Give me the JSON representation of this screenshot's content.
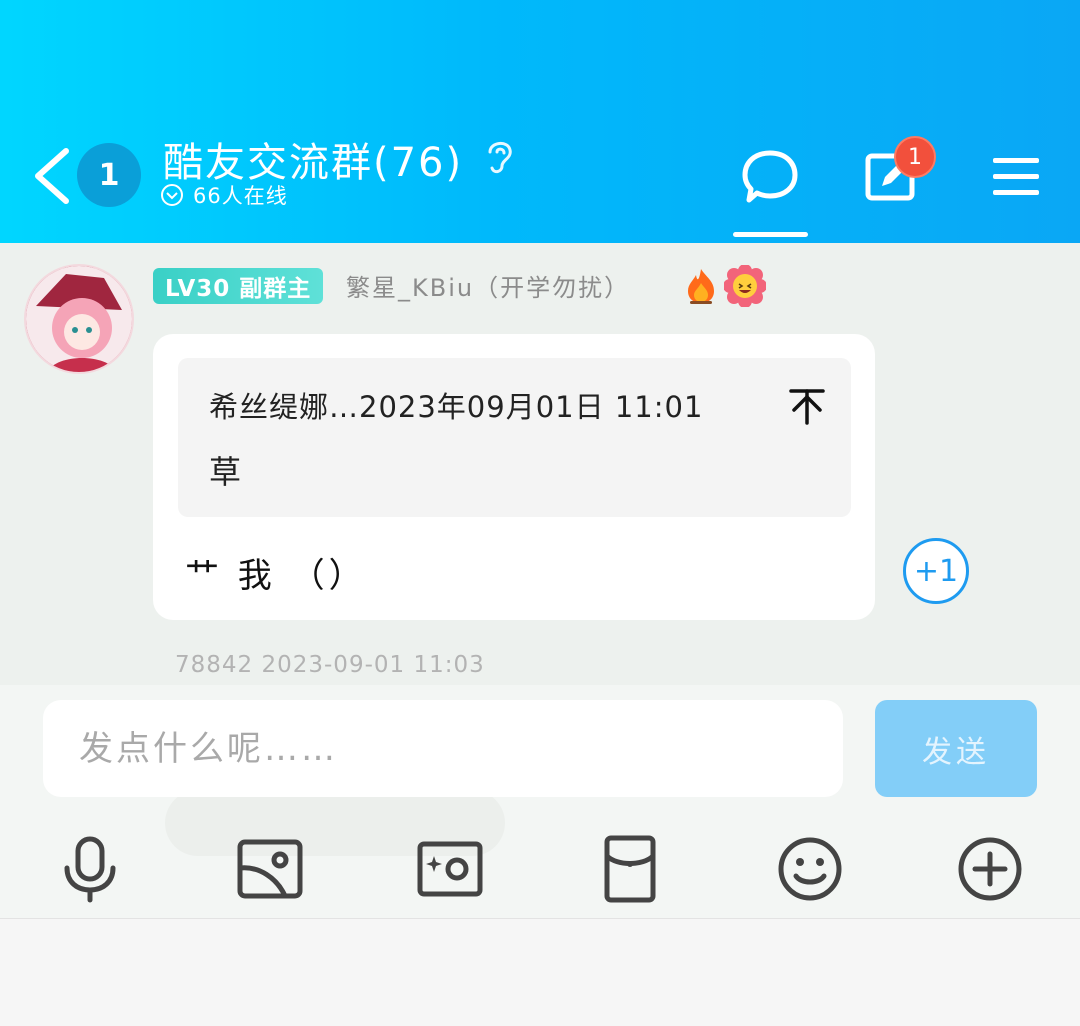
{
  "header": {
    "back_label": "back",
    "unread_count": "1",
    "title": "酷友交流群(76)",
    "online_text": "66人在线",
    "notification_badge": "1",
    "colors": {
      "gradient_start": "#00d6ff",
      "gradient_end": "#0aa7f5"
    },
    "icons": [
      "chevron-left-icon",
      "ear-icon",
      "chevron-down-circle-icon",
      "chat-bubble-icon",
      "edit-icon",
      "menu-icon"
    ]
  },
  "message": {
    "level_badge": "LV30 副群主",
    "nickname": "繁星_KBiu（开学勿扰）",
    "reply": {
      "meta": "希丝缇娜…2023年09月01日 11:01",
      "text": "草"
    },
    "text": "艹 我 （）",
    "plus_one": "+1",
    "footer": "78842   2023-09-01 11:03",
    "icons": [
      "fire-icon",
      "flower-face-icon",
      "jump-to-top-icon"
    ]
  },
  "composer": {
    "placeholder": "发点什么呢……",
    "send_label": "发送",
    "tools": [
      "microphone-icon",
      "image-icon",
      "camera-icon",
      "red-packet-icon",
      "emoji-icon",
      "add-icon"
    ],
    "colors": {
      "send_bg": "#83cef8"
    }
  }
}
